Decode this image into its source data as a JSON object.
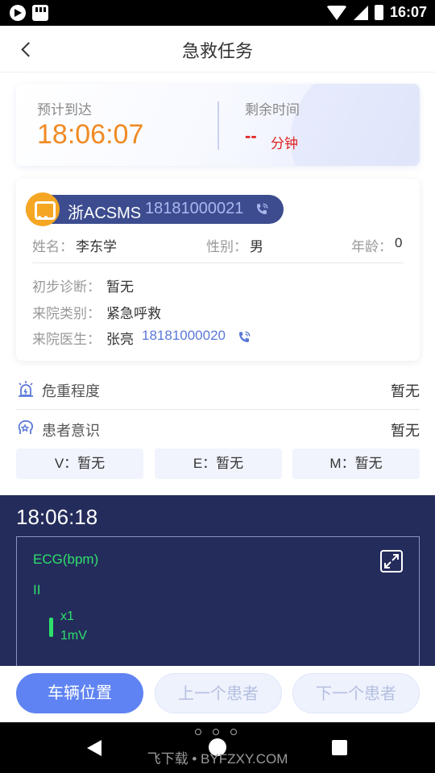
{
  "status_bar": {
    "time": "16:07"
  },
  "header": {
    "title": "急救任务"
  },
  "eta": {
    "label": "预计到达",
    "time": "18:06:07",
    "remaining_label": "剩余时间",
    "remaining_value": "--",
    "remaining_unit": "分钟"
  },
  "vehicle": {
    "plate": "浙ACSMS",
    "phone": "18181000021"
  },
  "patient": {
    "name_label": "姓名：",
    "name": "李东学",
    "gender_label": "性别：",
    "gender": "男",
    "age_label": "年龄：",
    "age": "0",
    "diagnosis_label": "初步诊断：",
    "diagnosis": "暂无",
    "category_label": "来院类别：",
    "category": "紧急呼救",
    "doctor_label": "来院医生：",
    "doctor": "张亮",
    "doctor_phone": "18181000020"
  },
  "severity": {
    "label": "危重程度",
    "value": "暂无"
  },
  "consciousness": {
    "label": "患者意识",
    "value": "暂无"
  },
  "gcs": [
    {
      "label": "V：暂无"
    },
    {
      "label": "E：暂无"
    },
    {
      "label": "M：暂无"
    }
  ],
  "ecg": {
    "time": "18:06:18",
    "title": "ECG(bpm)",
    "lead": "II",
    "gain": "x1",
    "amplitude": "1mV"
  },
  "actions": {
    "vehicle_location": "车辆位置",
    "prev_patient": "上一个患者",
    "next_patient": "下一个患者"
  },
  "watermark": "飞下载 • BYFZXY.COM",
  "colors": {
    "accent": "#5f83f2",
    "eta": "#f08a23",
    "alert": "#e02020",
    "ecg_bg": "#242c5c",
    "ecg_trace": "#2ee06a"
  }
}
